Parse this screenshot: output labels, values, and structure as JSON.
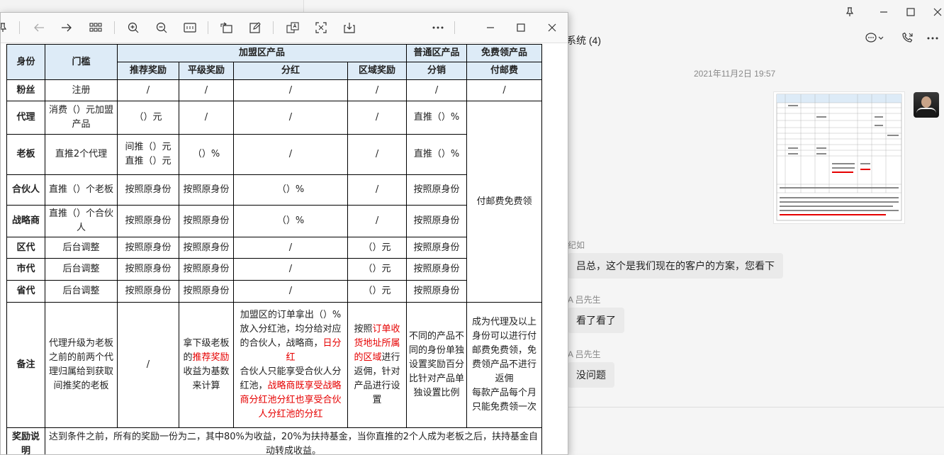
{
  "chat": {
    "title": "系统 (4)",
    "timestamp": "2021年11月2日 19:57",
    "messages": [
      {
        "sender": "纪如",
        "text": "吕总，这个是我们现在的客户的方案，您看下"
      },
      {
        "sender": "A 吕先生",
        "text": "看了看了"
      },
      {
        "sender": "A 吕先生",
        "text": "没问题"
      }
    ],
    "icons": {
      "pin": "pin-icon",
      "minimize": "minimize-icon",
      "maximize": "maximize-icon",
      "close": "close-icon",
      "chat": "chat-bubble-icon",
      "call": "phone-icon",
      "more": "more-icon"
    }
  },
  "viewer": {
    "toolbar_icons": [
      "pin-icon",
      "back-arrow-icon",
      "forward-arrow-icon",
      "grid-view-icon",
      "zoom-in-icon",
      "zoom-out-icon",
      "fit-icon",
      "rotate-icon",
      "edit-icon",
      "translate-icon",
      "crop-icon",
      "download-icon",
      "more-icon",
      "minimize-icon",
      "maximize-icon",
      "close-icon"
    ]
  },
  "table": {
    "headers": {
      "identity": "身份",
      "threshold": "门槛",
      "franchise_group": "加盟区产品",
      "normal_group": "普通区产品",
      "free_group": "免费领产品",
      "referral": "推荐奖励",
      "level_reward": "平级奖励",
      "dividend": "分红",
      "regional": "区域奖励",
      "distribution": "分销",
      "shipping": "付邮费"
    },
    "rows": [
      {
        "identity": "粉丝",
        "threshold": "注册",
        "referral": "/",
        "level_reward": "/",
        "dividend": "/",
        "regional": "/",
        "distribution": "/",
        "shipping": "/"
      },
      {
        "identity": "代理",
        "threshold": "消费（）元加盟产品",
        "referral": "（）元",
        "level_reward": "/",
        "dividend": "/",
        "regional": "/",
        "distribution": "直推（）%"
      },
      {
        "identity": "老板",
        "threshold": "直推2个代理",
        "referral": "间推（）元 直推（）元",
        "level_reward": "（）%",
        "dividend": "/",
        "regional": "/",
        "distribution": "直推（）%"
      },
      {
        "identity": "合伙人",
        "threshold": "直推（）个老板",
        "referral": "按照原身份",
        "level_reward": "按照原身份",
        "dividend": "（）%",
        "regional": "/",
        "distribution": "按照原身份"
      },
      {
        "identity": "战略商",
        "threshold": "直推（）个合伙人",
        "referral": "按照原身份",
        "level_reward": "按照原身份",
        "dividend": "（）%",
        "regional": "/",
        "distribution": "按照原身份"
      },
      {
        "identity": "区代",
        "threshold": "后台调整",
        "referral": "按照原身份",
        "level_reward": "按照原身份",
        "dividend": "/",
        "regional": "（）元",
        "distribution": "按照原身份"
      },
      {
        "identity": "市代",
        "threshold": "后台调整",
        "referral": "按照原身份",
        "level_reward": "按照原身份",
        "dividend": "/",
        "regional": "（）元",
        "distribution": "按照原身份"
      },
      {
        "identity": "省代",
        "threshold": "后台调整",
        "referral": "按照原身份",
        "level_reward": "按照原身份",
        "dividend": "/",
        "regional": "（）元",
        "distribution": "按照原身份"
      }
    ],
    "shipping_merged": "付邮费免费领",
    "remarks": {
      "label": "备注",
      "threshold": "代理升级为老板之前的前两个代理归属给到获取间推奖的老板",
      "referral": "/",
      "level_reward_a": "拿下级老板的",
      "level_reward_red": "推荐奖励",
      "level_reward_b": "收益为基数来计算",
      "dividend_a": "加盟区的订单拿出（）%放入分红池，均分给对应的合伙人，战略商，",
      "dividend_red1": "日分红",
      "dividend_b": "合伙人只能享受合伙人分红池，",
      "dividend_red2": "战略商既享受战略商分红池分红也享受合伙人分红池的分红",
      "regional_a": "按照",
      "regional_red": "订单收货地址所属的区域",
      "regional_b": "进行返佣，针对产品进行设置",
      "distribution": "不同的产品不同的身份单独设置奖励百分比针对产品单独设置比例",
      "shipping_a": "成为代理及以上身份可以进行付邮费免费领，免费领产品不进行返佣",
      "shipping_b": "每款产品每个月只能免费领一次"
    },
    "reward_note": {
      "label": "奖励说明",
      "text": "达到条件之前，所有的奖励一份为二，其中80%为收益，20%为扶持基金，当你直推的2个人成为老板之后，扶持基金自动转成收益。"
    }
  }
}
